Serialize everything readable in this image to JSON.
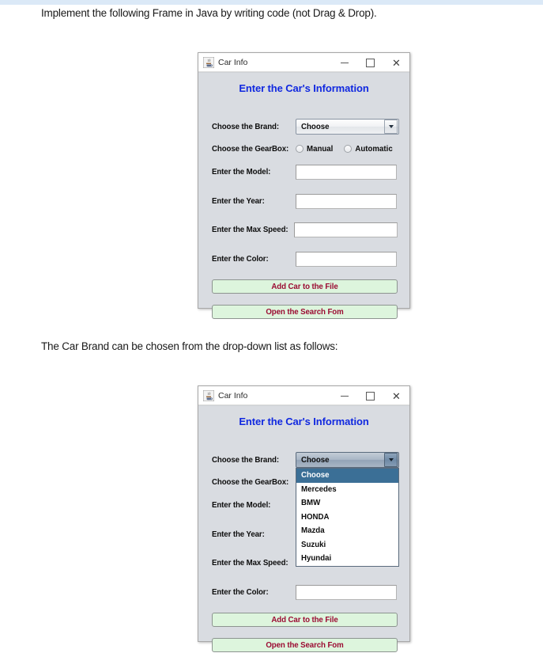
{
  "document": {
    "intro_text": "Implement the following Frame in Java by writing code (not Drag & Drop).",
    "dropdown_text": "The Car Brand can be chosen from the drop-down list as follows:"
  },
  "colors": {
    "heading_blue": "#1028e0",
    "button_text_dark_red": "#9b0b32",
    "button_bg_light_green": "#ddf5dd",
    "window_body_gray": "#d9dce1",
    "dropdown_highlight": "#3b6f96",
    "top_band_blue": "#dbe9f7"
  },
  "window": {
    "title": "Car Info",
    "app_icon": "java-coffee-cup-icon",
    "controls": {
      "minimize": "minimize-icon",
      "maximize": "maximize-icon",
      "close": "close-icon"
    },
    "heading": "Enter the Car's Information",
    "labels": {
      "brand": "Choose the Brand:",
      "gearbox": "Choose the GearBox:",
      "model": "Enter the Model:",
      "year": "Enter the Year:",
      "max_speed": "Enter the Max Speed:",
      "color": "Enter the Color:"
    },
    "brand_combo": {
      "selected": "Choose",
      "options": [
        "Choose",
        "Mercedes",
        "BMW",
        "HONDA",
        "Mazda",
        "Suzuki",
        "Hyundai"
      ]
    },
    "gearbox": {
      "manual": "Manual",
      "automatic": "Automatic",
      "selected": ""
    },
    "inputs": {
      "model": "",
      "year": "",
      "max_speed": "",
      "color": ""
    },
    "buttons": {
      "add_car": "Add Car to the File",
      "open_search": "Open the Search Fom"
    }
  }
}
